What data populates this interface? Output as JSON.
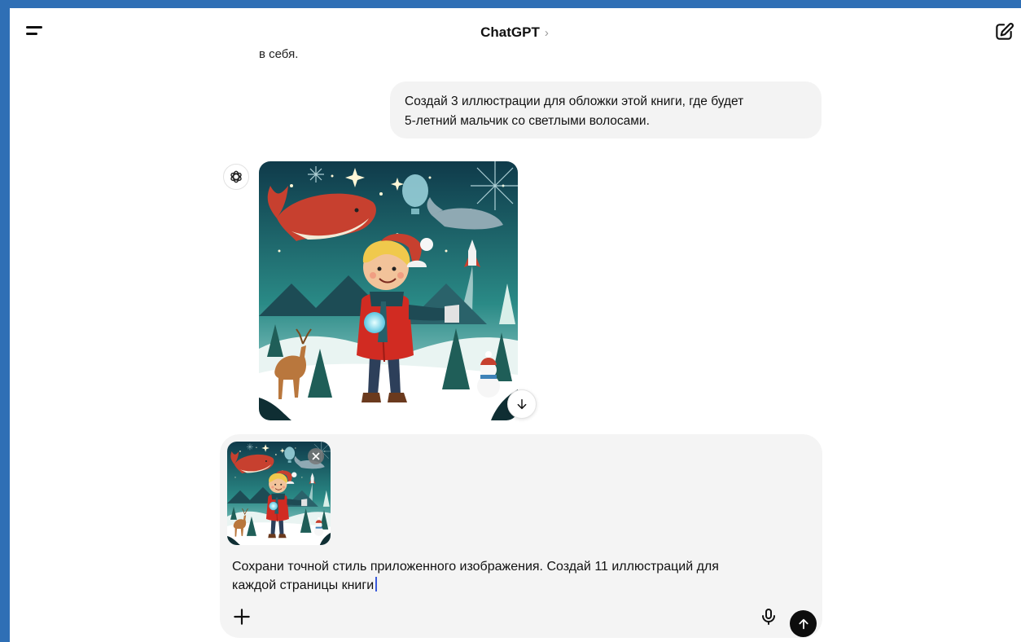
{
  "header": {
    "title": "ChatGPT",
    "chevron": "›",
    "menu_icon": "hamburger-icon",
    "edit_icon": "new-chat-icon"
  },
  "conversation": {
    "previous_text_fragment": "в себя.",
    "user_message": {
      "line1": "Создай 3 иллюстрации для обложки этой книги, где будет",
      "line2": "5-летний мальчик со светлыми волосами."
    },
    "assistant": {
      "avatar_icon": "openai-logo-icon",
      "image_alt": "Generated illustration: boy in red coat in a winter fantasy scene",
      "download_icon": "arrow-down-icon"
    }
  },
  "composer": {
    "attachment_alt": "Attached illustration thumbnail",
    "text_line1": "Сохрани точной стиль приложенного изображения. Создай 11 иллюстраций для",
    "text_line2": "каждой страницы книги",
    "add_icon": "plus-icon",
    "mic_icon": "microphone-icon",
    "send_icon": "arrow-up-icon"
  },
  "colors": {
    "frame": "#2f6fb5",
    "bubble": "#f3f3f3",
    "composer": "#f4f4f4",
    "send": "#0d0d0d"
  }
}
